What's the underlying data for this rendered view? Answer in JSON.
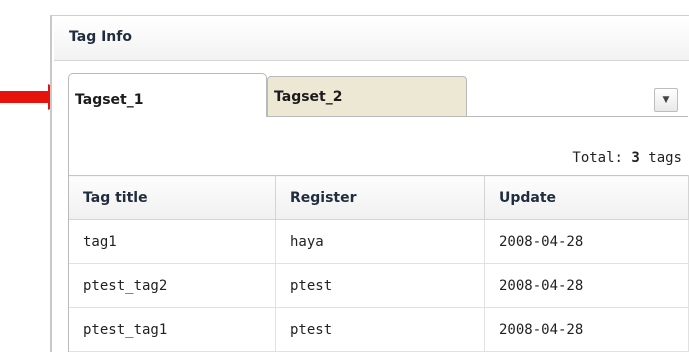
{
  "panel": {
    "title": "Tag Info"
  },
  "tabs": [
    {
      "label": "Tagset_1",
      "active": true
    },
    {
      "label": "Tagset_2",
      "active": false
    }
  ],
  "dropdown": {
    "icon": "caret-down-icon",
    "glyph": "▼"
  },
  "summary": {
    "prefix": "Total: ",
    "count": "3",
    "suffix": " tags"
  },
  "table": {
    "columns": [
      "Tag title",
      "Register",
      "Update"
    ],
    "rows": [
      [
        "tag1",
        "haya",
        "2008-04-28"
      ],
      [
        "ptest_tag2",
        "ptest",
        "2008-04-28"
      ],
      [
        "ptest_tag1",
        "ptest",
        "2008-04-28"
      ]
    ]
  },
  "annotation": {
    "icon": "red-arrow-icon",
    "color": "#e8120c"
  }
}
